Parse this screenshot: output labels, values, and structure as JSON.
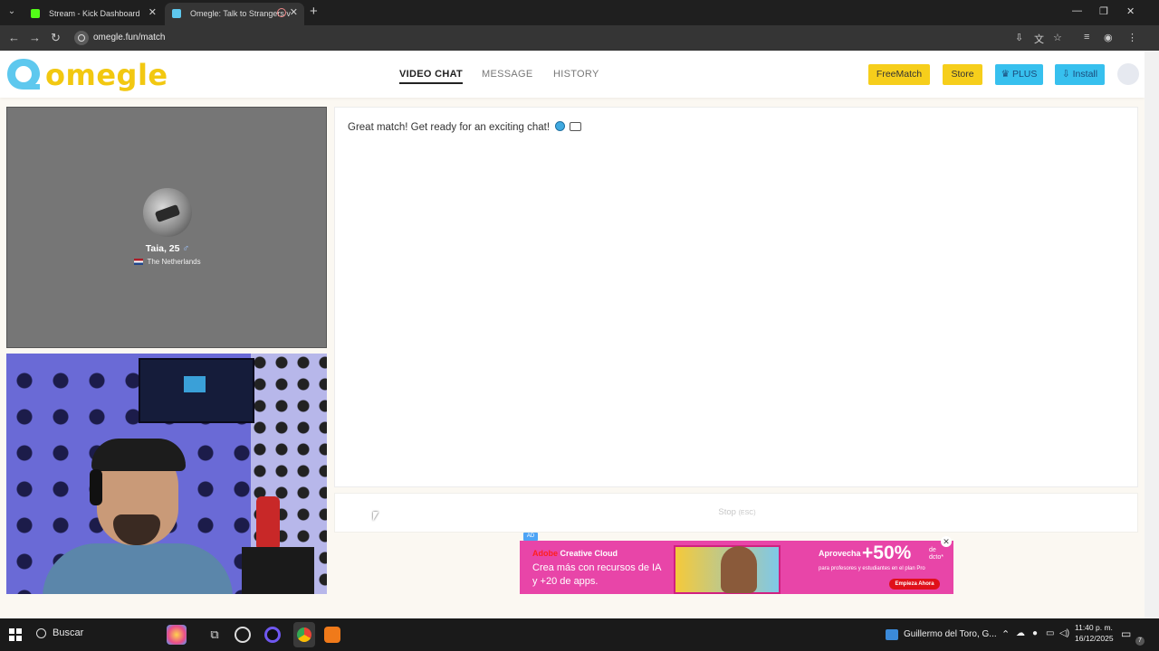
{
  "browser": {
    "tabs": [
      {
        "title": "Stream - Kick Dashboard",
        "favicon_color": "#53fc18"
      },
      {
        "title": "Omegle: Talk to Strangers v",
        "favicon_color": "#5ec8ee"
      }
    ],
    "url": "omegle.fun/match"
  },
  "header": {
    "logo_text": "omegle",
    "nav": [
      "VIDEO CHAT",
      "MESSAGE",
      "HISTORY"
    ],
    "buttons": {
      "freematch": "FreeMatch",
      "store": "Store",
      "plus": "PLUS",
      "install": "Install"
    }
  },
  "remote": {
    "name": "Taia, 25",
    "gender_symbol": "♂",
    "country": "The Netherlands"
  },
  "chat": {
    "message": "Great match! Get ready for an exciting chat!"
  },
  "stop": {
    "label": "Stop",
    "hint": "(ESC)"
  },
  "ad": {
    "tag": "AD",
    "brand_red": "Adobe",
    "brand_white": "Creative Cloud",
    "line1": "Crea más con recursos de IA",
    "line2": "y +20 de apps.",
    "promo": "Aprovecha",
    "percent": "+50%",
    "dcto_1": "de",
    "dcto_2": "dcto*",
    "sub": "para profesores y estudiantes en el plan Pro",
    "cta": "Empieza Ahora"
  },
  "taskbar": {
    "search_label": "Buscar",
    "widget_text": "Guillermo del Toro, G...",
    "time": "11:40 p. m.",
    "date": "16/12/2025",
    "notification_count": "7"
  },
  "colors": {
    "brand_yellow": "#f2c811",
    "brand_blue": "#37c0ee",
    "ad_pink": "#e845a8"
  }
}
